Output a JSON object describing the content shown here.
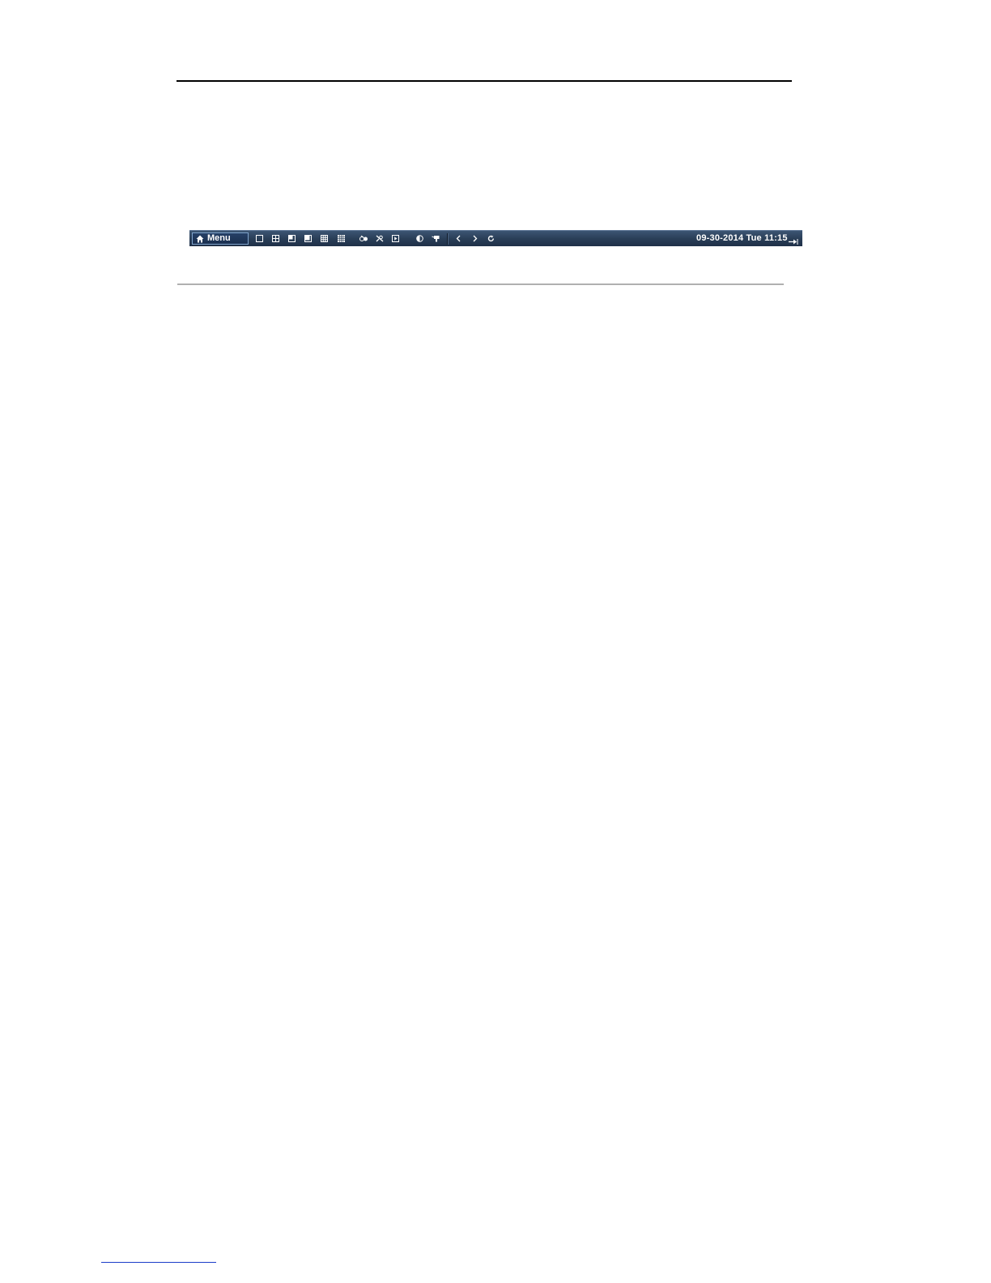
{
  "toolbar": {
    "menu_label": "Menu",
    "datetime": "09-30-2014 Tue 11:15",
    "icons": [
      "single-screen-icon",
      "quad-screen-icon",
      "six-screen-icon",
      "eight-screen-icon",
      "nine-screen-icon",
      "sixteen-screen-icon",
      "start-recording-icon",
      "stop-recording-icon",
      "playback-icon",
      "image-settings-icon",
      "ptz-control-icon",
      "previous-screen-icon",
      "next-screen-icon",
      "auto-switch-icon",
      "pin-toolbar-icon"
    ]
  }
}
